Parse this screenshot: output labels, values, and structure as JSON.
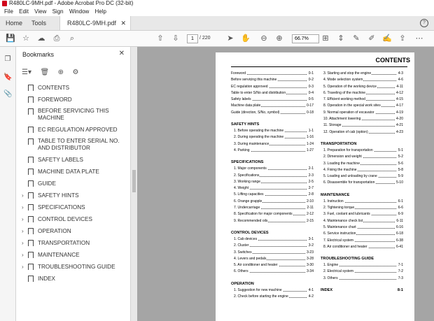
{
  "window": {
    "title": "R480LC-9MH.pdf - Adobe Acrobat Pro DC (32-bit)"
  },
  "menu": [
    "File",
    "Edit",
    "View",
    "Sign",
    "Window",
    "Help"
  ],
  "tabs": {
    "home": "Home",
    "tools": "Tools",
    "doc": "R480LC-9MH.pdf"
  },
  "toolbar": {
    "page_current": "1",
    "page_total": "/ 220",
    "zoom": "66.7%"
  },
  "bookmarks": {
    "title": "Bookmarks",
    "items": [
      {
        "label": "CONTENTS",
        "expandable": false
      },
      {
        "label": "FOREWORD",
        "expandable": false
      },
      {
        "label": "BEFORE SERVICING THIS MACHINE",
        "expandable": false
      },
      {
        "label": "EC REGULATION APPROVED",
        "expandable": false
      },
      {
        "label": "TABLE TO ENTER SERIAL NO. AND DISTRIBUTOR",
        "expandable": false
      },
      {
        "label": "SAFETY LABELS",
        "expandable": false
      },
      {
        "label": "MACHINE DATA PLATE",
        "expandable": false
      },
      {
        "label": "GUIDE",
        "expandable": false
      },
      {
        "label": "SAFETY HINTS",
        "expandable": true
      },
      {
        "label": "SPECIFICATIONS",
        "expandable": true
      },
      {
        "label": "CONTROL DEVICES",
        "expandable": true
      },
      {
        "label": "OPERATION",
        "expandable": true
      },
      {
        "label": "TRANSPORTATION",
        "expandable": true
      },
      {
        "label": "MAINTENANCE",
        "expandable": true
      },
      {
        "label": "TROUBLESHOOTING GUIDE",
        "expandable": true
      },
      {
        "label": "INDEX",
        "expandable": false
      }
    ]
  },
  "document": {
    "title": "CONTENTS",
    "left": [
      {
        "type": "row",
        "text": "Foreword",
        "page": "0-1"
      },
      {
        "type": "row",
        "text": "Before servicing this machine",
        "page": "0-2"
      },
      {
        "type": "row",
        "text": "EC regulation approved",
        "page": "0-3"
      },
      {
        "type": "row",
        "text": "Table to enter S/No and distribution",
        "page": "0-4"
      },
      {
        "type": "row",
        "text": "Safety labels",
        "page": "0-5"
      },
      {
        "type": "row",
        "text": "Machine data plate",
        "page": "0-17"
      },
      {
        "type": "row",
        "text": "Guide (direction, S/No, symbol)",
        "page": "0-18"
      },
      {
        "type": "sec",
        "text": "SAFETY HINTS"
      },
      {
        "type": "sub",
        "text": "1. Before operating the machine",
        "page": "1-1"
      },
      {
        "type": "sub",
        "text": "2. During operating the machine",
        "page": "1-16"
      },
      {
        "type": "sub",
        "text": "3. During maintenance",
        "page": "1-24"
      },
      {
        "type": "sub",
        "text": "4. Parking",
        "page": "1-27"
      },
      {
        "type": "sec",
        "text": "SPECIFICATIONS"
      },
      {
        "type": "sub",
        "text": "1. Major components",
        "page": "2-1"
      },
      {
        "type": "sub",
        "text": "2. Specifications",
        "page": "2-3"
      },
      {
        "type": "sub",
        "text": "3. Working range",
        "page": "2-5"
      },
      {
        "type": "sub",
        "text": "4. Weight",
        "page": "2-7"
      },
      {
        "type": "sub",
        "text": "5. Lifting capacities",
        "page": "2-8"
      },
      {
        "type": "sub",
        "text": "6. Orange grapple",
        "page": "2-10"
      },
      {
        "type": "sub",
        "text": "7. Undercarriage",
        "page": "2-11"
      },
      {
        "type": "sub",
        "text": "8. Specification for major components",
        "page": "2-12"
      },
      {
        "type": "sub",
        "text": "9. Recommended oils",
        "page": "2-15"
      },
      {
        "type": "sec",
        "text": "CONTROL DEVICES"
      },
      {
        "type": "sub",
        "text": "1. Cab devices",
        "page": "3-1"
      },
      {
        "type": "sub",
        "text": "2. Cluster",
        "page": "3-2"
      },
      {
        "type": "sub",
        "text": "3. Switches",
        "page": "3-23"
      },
      {
        "type": "sub",
        "text": "4. Levers and pedals",
        "page": "3-28"
      },
      {
        "type": "sub",
        "text": "5. Air conditioner and heater",
        "page": "3-30"
      },
      {
        "type": "sub",
        "text": "6. Others",
        "page": "3-34"
      },
      {
        "type": "sec",
        "text": "OPERATION"
      },
      {
        "type": "sub",
        "text": "1. Suggestion for new machine",
        "page": "4-1"
      },
      {
        "type": "sub",
        "text": "2. Check before starting the engine",
        "page": "4-2"
      }
    ],
    "right": [
      {
        "type": "sub",
        "text": "3. Starting and stop the engine",
        "page": "4-3"
      },
      {
        "type": "sub",
        "text": "4. Mode selection system",
        "page": "4-6"
      },
      {
        "type": "sub",
        "text": "5. Operation of the working device",
        "page": "4-11"
      },
      {
        "type": "sub",
        "text": "6. Traveling of the machine",
        "page": "4-12"
      },
      {
        "type": "sub",
        "text": "7. Efficient working method",
        "page": "4-15"
      },
      {
        "type": "sub",
        "text": "8. Operation in the special work sites",
        "page": "4-17"
      },
      {
        "type": "sub",
        "text": "9. Normal operation of excavator",
        "page": "4-19"
      },
      {
        "type": "sub",
        "text": "10. Attachment lowering",
        "page": "4-20"
      },
      {
        "type": "sub",
        "text": "11. Storage",
        "page": "4-21"
      },
      {
        "type": "sub",
        "text": "12. Operation of cab (option)",
        "page": "4-23"
      },
      {
        "type": "sec",
        "text": "TRANSPORTATION"
      },
      {
        "type": "sub",
        "text": "1. Preparation for transportation",
        "page": "5-1"
      },
      {
        "type": "sub",
        "text": "2. Dimension and weight",
        "page": "5-2"
      },
      {
        "type": "sub",
        "text": "3. Loading the machine",
        "page": "5-6"
      },
      {
        "type": "sub",
        "text": "4. Fixing the machine",
        "page": "5-8"
      },
      {
        "type": "sub",
        "text": "5. Loading and unloading by crane",
        "page": "5-9"
      },
      {
        "type": "sub",
        "text": "6. Disassemble for transportation",
        "page": "5-10"
      },
      {
        "type": "sec",
        "text": "MAINTENANCE"
      },
      {
        "type": "sub",
        "text": "1. Instruction",
        "page": "6-1"
      },
      {
        "type": "sub",
        "text": "2. Tightening torque",
        "page": "6-6"
      },
      {
        "type": "sub",
        "text": "3. Fuel, coolant and lubricants",
        "page": "6-9"
      },
      {
        "type": "sub",
        "text": "4. Maintenance check list",
        "page": "6-11"
      },
      {
        "type": "sub",
        "text": "5. Maintenance chart",
        "page": "6-16"
      },
      {
        "type": "sub",
        "text": "6. Service instruction",
        "page": "6-18"
      },
      {
        "type": "sub",
        "text": "7. Electrical system",
        "page": "6-38"
      },
      {
        "type": "sub",
        "text": "8. Air conditioner and heater",
        "page": "6-41"
      },
      {
        "type": "sec",
        "text": "TROUBLESHOOTING GUIDE"
      },
      {
        "type": "sub",
        "text": "1. Engine",
        "page": "7-1"
      },
      {
        "type": "sub",
        "text": "2. Electrical system",
        "page": "7-2"
      },
      {
        "type": "sub",
        "text": "3. Others",
        "page": "7-3"
      },
      {
        "type": "sec",
        "text": "INDEX",
        "page": "8-1"
      }
    ]
  }
}
